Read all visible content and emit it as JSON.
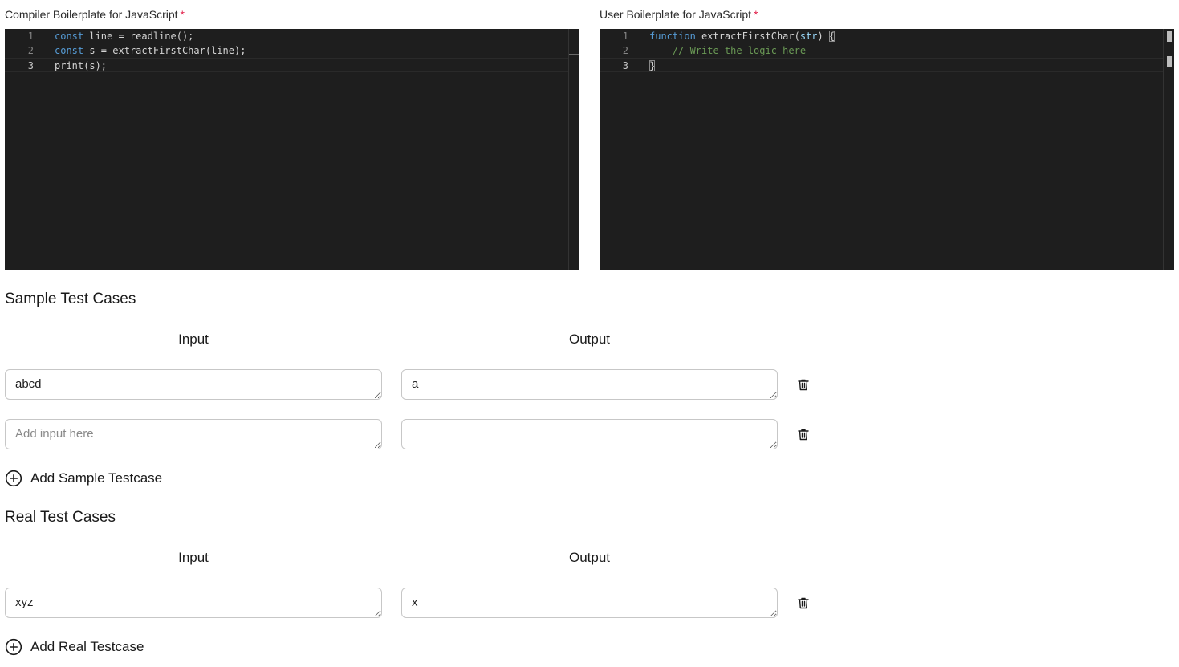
{
  "compiler_editor": {
    "label": "Compiler Boilerplate for JavaScript",
    "required_mark": "*",
    "lines": [
      {
        "number": "1",
        "tokens": [
          {
            "t": "const",
            "c": "kw"
          },
          {
            "t": " line = readline();",
            "c": "fn"
          }
        ]
      },
      {
        "number": "2",
        "tokens": [
          {
            "t": "const",
            "c": "kw"
          },
          {
            "t": " s = extractFirstChar(line);",
            "c": "fn"
          }
        ]
      },
      {
        "number": "3",
        "tokens": [
          {
            "t": "print(s);",
            "c": "fn"
          }
        ]
      }
    ]
  },
  "user_editor": {
    "label": "User Boilerplate for JavaScript",
    "required_mark": "*",
    "lines": [
      {
        "number": "1",
        "tokens": [
          {
            "t": "function",
            "c": "kw"
          },
          {
            "t": " extractFirstChar(",
            "c": "fn"
          },
          {
            "t": "str",
            "c": "param"
          },
          {
            "t": ") ",
            "c": "fn"
          },
          {
            "t": "{",
            "c": "brace"
          }
        ]
      },
      {
        "number": "2",
        "tokens": [
          {
            "t": "    // Write the logic here",
            "c": "cmt"
          }
        ]
      },
      {
        "number": "3",
        "tokens": [
          {
            "t": "}",
            "c": "brace"
          }
        ]
      }
    ]
  },
  "sample_tests": {
    "title": "Sample Test Cases",
    "input_header": "Input",
    "output_header": "Output",
    "rows": [
      {
        "input": "abcd",
        "output": "a",
        "input_placeholder": "Add input here",
        "output_placeholder": ""
      },
      {
        "input": "",
        "output": "",
        "input_placeholder": "Add input here",
        "output_placeholder": ""
      }
    ],
    "add_label": "Add Sample Testcase"
  },
  "real_tests": {
    "title": "Real Test Cases",
    "input_header": "Input",
    "output_header": "Output",
    "rows": [
      {
        "input": "xyz",
        "output": "x",
        "input_placeholder": "Add input here",
        "output_placeholder": ""
      }
    ],
    "add_label": "Add Real Testcase"
  },
  "icons": {
    "delete": "trash-icon",
    "add": "plus-circle-icon"
  }
}
